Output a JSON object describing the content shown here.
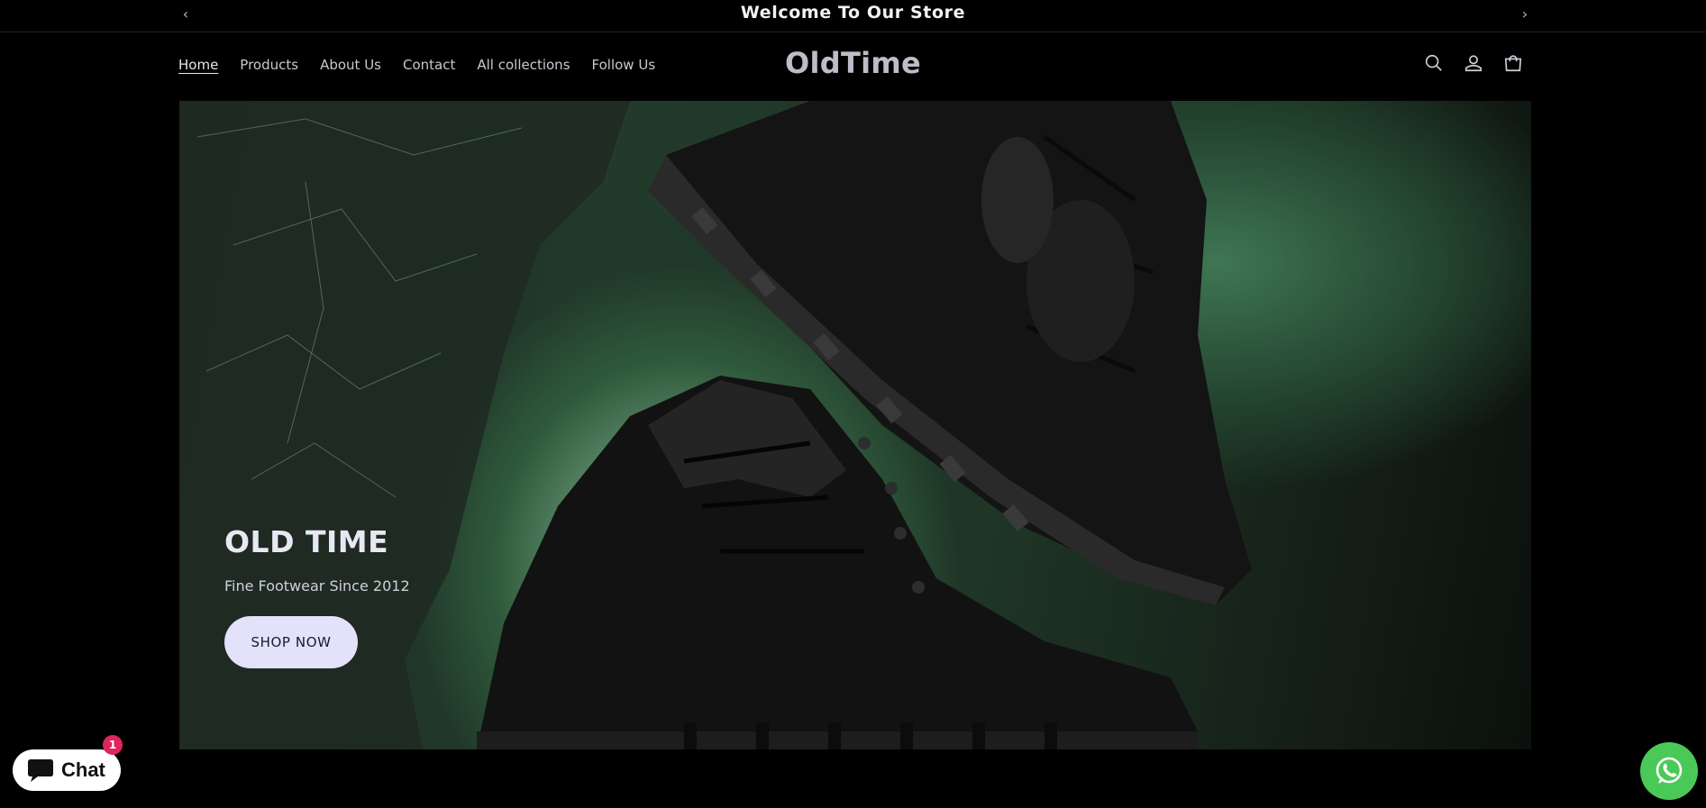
{
  "announcement": {
    "text": "Welcome To Our Store",
    "prev_icon": "chevron-left-icon",
    "next_icon": "chevron-right-icon"
  },
  "header": {
    "logo": "OldTime",
    "nav": [
      {
        "label": "Home",
        "active": true
      },
      {
        "label": "Products"
      },
      {
        "label": "About Us"
      },
      {
        "label": "Contact"
      },
      {
        "label": "All collections"
      },
      {
        "label": "Follow Us"
      }
    ],
    "icons": [
      "search-icon",
      "account-icon",
      "cart-icon"
    ]
  },
  "hero": {
    "title": "OLD TIME",
    "subtitle": "Fine Footwear Since 2012",
    "button_label": "SHOP NOW"
  },
  "chat_widget": {
    "label": "Chat",
    "badge_count": "1"
  },
  "whatsapp": {
    "icon": "whatsapp-icon",
    "color": "#4ac959"
  },
  "colors": {
    "background": "#000000",
    "button_bg": "#e4e1fb",
    "badge": "#e0245e"
  }
}
